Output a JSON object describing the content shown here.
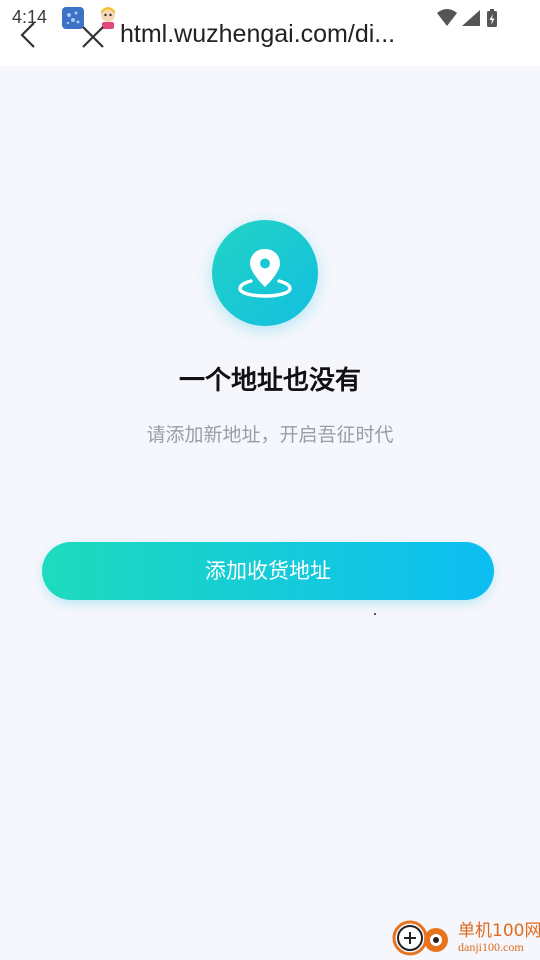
{
  "status_bar": {
    "time": "4:14"
  },
  "browser": {
    "url": "html.wuzhengai.com/di..."
  },
  "empty_state": {
    "icon": "location-pin-icon",
    "title": "一个地址也没有",
    "subtitle": "请添加新地址，开启吾征时代"
  },
  "add_button": {
    "label": "添加收货地址"
  },
  "watermark": {
    "name": "单机100网",
    "url": "danji100.com"
  },
  "colors": {
    "accent_start": "#1edbbd",
    "accent_end": "#0cbdf2",
    "background": "#f5f7fc"
  }
}
